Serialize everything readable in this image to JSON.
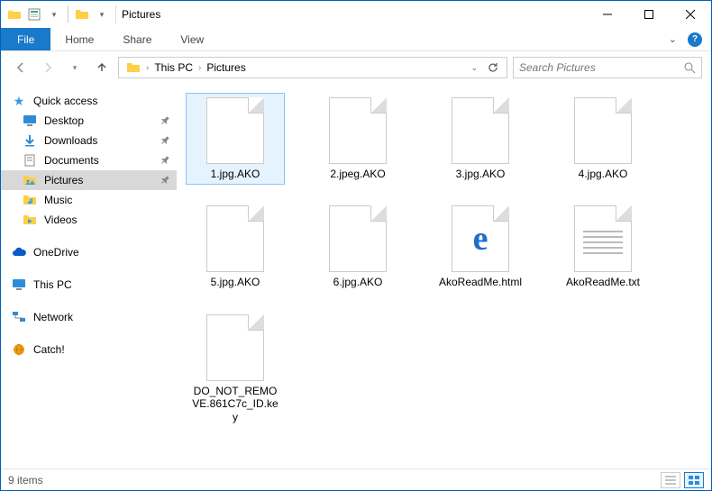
{
  "titlebar": {
    "title": "Pictures"
  },
  "ribbon": {
    "file": "File",
    "tabs": [
      "Home",
      "Share",
      "View"
    ]
  },
  "breadcrumb": {
    "segments": [
      "This PC",
      "Pictures"
    ]
  },
  "search": {
    "placeholder": "Search Pictures"
  },
  "sidebar": {
    "quick_access": {
      "label": "Quick access",
      "items": [
        {
          "label": "Desktop",
          "icon": "desktop",
          "pinned": true
        },
        {
          "label": "Downloads",
          "icon": "downloads",
          "pinned": true
        },
        {
          "label": "Documents",
          "icon": "documents",
          "pinned": true
        },
        {
          "label": "Pictures",
          "icon": "pictures",
          "pinned": true,
          "selected": true
        },
        {
          "label": "Music",
          "icon": "music",
          "pinned": false
        },
        {
          "label": "Videos",
          "icon": "videos",
          "pinned": false
        }
      ]
    },
    "onedrive": {
      "label": "OneDrive"
    },
    "thispc": {
      "label": "This PC"
    },
    "network": {
      "label": "Network"
    },
    "catch": {
      "label": "Catch!"
    }
  },
  "files": {
    "items": [
      {
        "name": "1.jpg.AKO",
        "type": "blank",
        "selected": true
      },
      {
        "name": "2.jpeg.AKO",
        "type": "blank"
      },
      {
        "name": "3.jpg.AKO",
        "type": "blank"
      },
      {
        "name": "4.jpg.AKO",
        "type": "blank"
      },
      {
        "name": "5.jpg.AKO",
        "type": "blank"
      },
      {
        "name": "6.jpg.AKO",
        "type": "blank"
      },
      {
        "name": "AkoReadMe.html",
        "type": "html"
      },
      {
        "name": "AkoReadMe.txt",
        "type": "txt"
      },
      {
        "name": "DO_NOT_REMOVE.861C7c_ID.key",
        "type": "blank"
      }
    ]
  },
  "status": {
    "count_text": "9 items"
  }
}
